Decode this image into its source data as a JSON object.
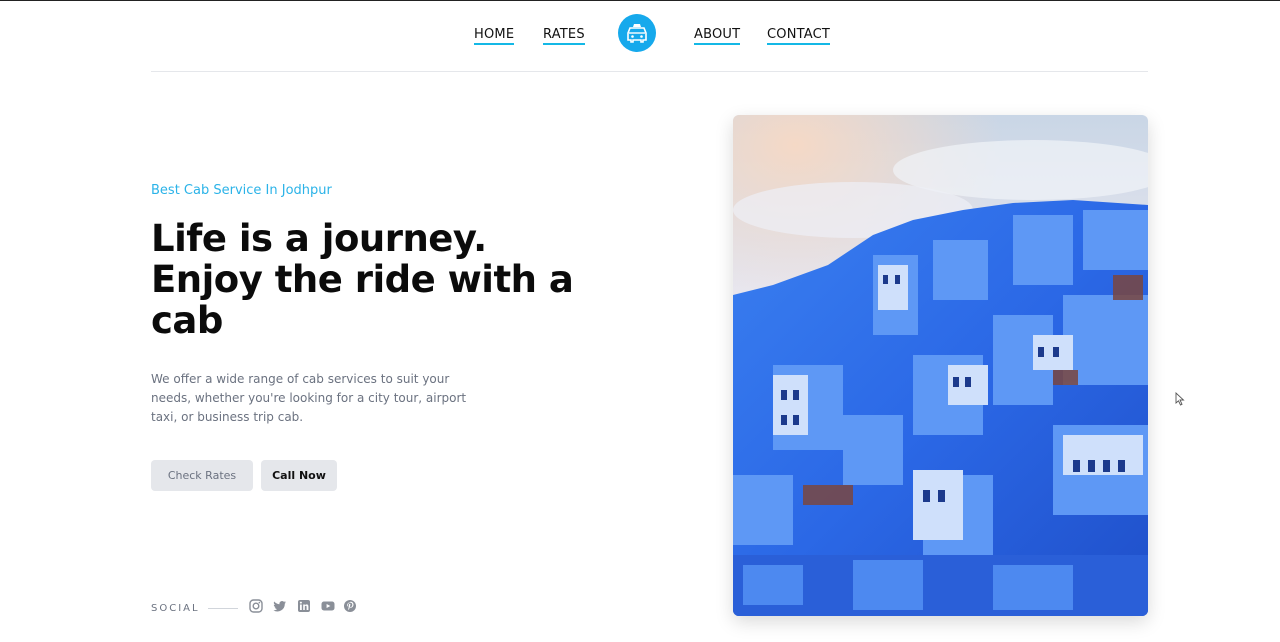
{
  "nav": {
    "home": "HOME",
    "rates": "RATES",
    "about": "ABOUT",
    "contact": "CONTACT",
    "logo_icon": "taxi-icon"
  },
  "hero": {
    "eyebrow": "Best Cab Service In Jodhpur",
    "headline_line1": "Life is a journey.",
    "headline_line2": "Enjoy the ride with a",
    "headline_line3": "cab",
    "description": "We offer a wide range of cab services to suit your needs, whether you're looking for a city tour, airport taxi, or business trip cab.",
    "check_rates_label": "Check Rates",
    "call_now_label": "Call Now"
  },
  "social": {
    "label": "SOCIAL",
    "icons": [
      "instagram-icon",
      "twitter-icon",
      "linkedin-icon",
      "youtube-icon",
      "pinterest-icon"
    ]
  },
  "colors": {
    "accent": "#14b8e6",
    "logo_bg": "#16a9ec",
    "button_bg": "#e5e7eb"
  }
}
